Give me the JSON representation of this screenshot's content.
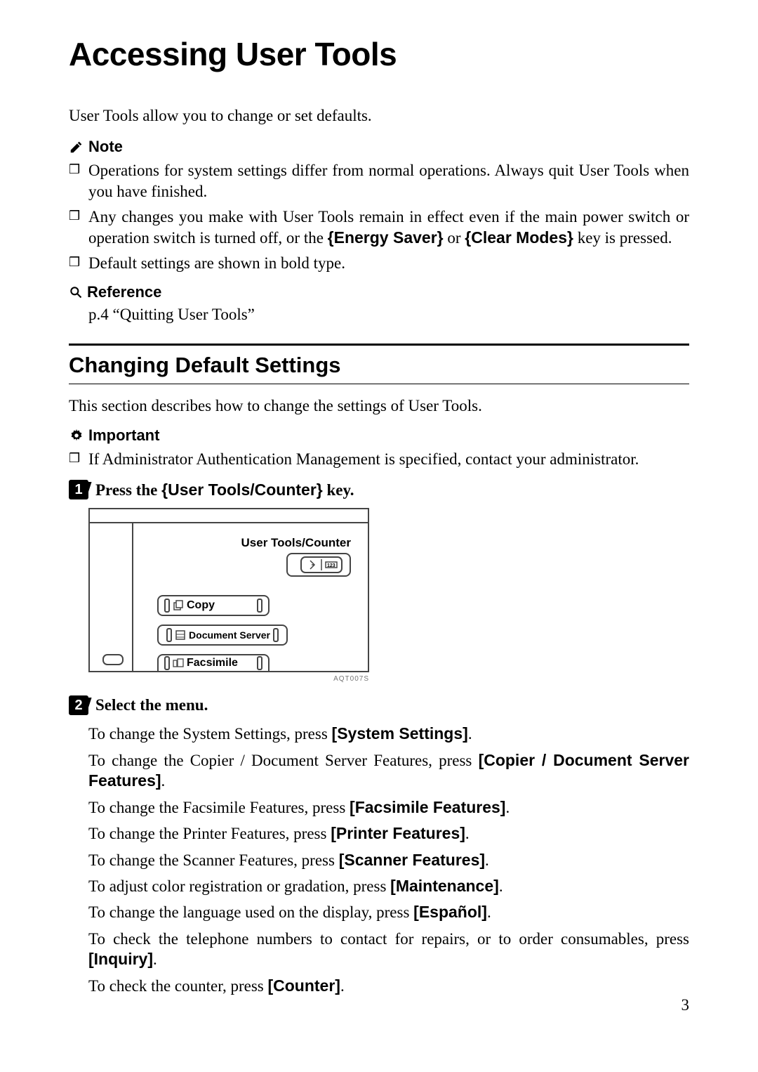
{
  "title": "Accessing User Tools",
  "intro": "User Tools allow you to change or set defaults.",
  "note_label": "Note",
  "notes": {
    "n1": "Operations for system settings differ from normal operations. Always quit User Tools when you have finished.",
    "n2a": "Any changes you make with User Tools remain in effect even if the main power switch or operation switch is turned off, or the ",
    "n2_key1": "Energy Saver",
    "n2b": " or ",
    "n2_key2": "Clear Modes",
    "n2c": " key is pressed.",
    "n3": "Default settings are shown in bold type."
  },
  "ref_label": "Reference",
  "ref_body": "p.4 “Quitting User Tools”",
  "section_heading": "Changing Default Settings",
  "section_intro": "This section describes how to change the settings of User Tools.",
  "important_label": "Important",
  "important_body": "If Administrator Authentication Management is specified, contact your administrator.",
  "step1": {
    "num": "1",
    "pre": "Press the ",
    "key": "User Tools/Counter",
    "post": " key."
  },
  "figure": {
    "label_userct": "User Tools/Counter",
    "key_copy": "Copy",
    "key_doc": "Document Server",
    "key_fax": "Facsimile",
    "caption": "AQT007S"
  },
  "step2": {
    "num": "2",
    "text": "Select the menu."
  },
  "menu": {
    "m1a": "To change the System Settings, press ",
    "m1b": "[System Settings]",
    "m1c": ".",
    "m2a": "To change the Copier / Document Server Features, press ",
    "m2b": "[Copier / Document Server Features]",
    "m2c": ".",
    "m3a": "To change the Facsimile Features, press ",
    "m3b": "[Facsimile Features]",
    "m3c": ".",
    "m4a": "To change the Printer Features, press ",
    "m4b": "[Printer Features]",
    "m4c": ".",
    "m5a": "To change the Scanner Features, press ",
    "m5b": "[Scanner Features]",
    "m5c": ".",
    "m6a": "To adjust color registration or gradation, press ",
    "m6b": "[Maintenance]",
    "m6c": ".",
    "m7a": "To change the language used on the display, press ",
    "m7b": "[Español]",
    "m7c": ".",
    "m8a": "To check the telephone numbers to contact for repairs, or to order consumables, press ",
    "m8b": "[Inquiry]",
    "m8c": ".",
    "m9a": "To check the counter, press ",
    "m9b": "[Counter]",
    "m9c": "."
  },
  "page_number": "3",
  "brackets": {
    "l": "{",
    "r": "}"
  }
}
